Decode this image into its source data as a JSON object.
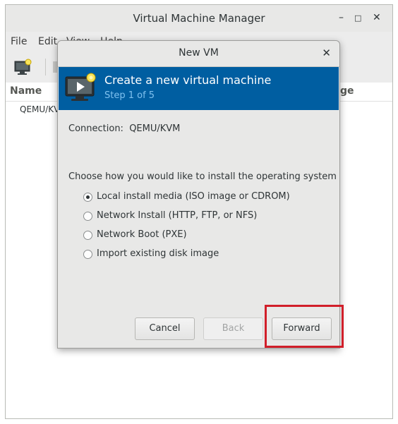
{
  "main_window": {
    "title": "Virtual Machine Manager",
    "menu": [
      "File",
      "Edit",
      "View",
      "Help"
    ],
    "columns": {
      "name": "Name",
      "usage": "ge"
    },
    "connections": [
      "QEMU/KV"
    ]
  },
  "dialog": {
    "title": "New VM",
    "banner": {
      "title": "Create a new virtual machine",
      "step": "Step 1 of 5"
    },
    "connection": "Connection:  QEMU/KVM",
    "install_prompt": "Choose how you would like to install the operating system",
    "options": [
      {
        "label": "Local install media (ISO image or CDROM)",
        "selected": true
      },
      {
        "label": "Network Install (HTTP, FTP, or NFS)",
        "selected": false
      },
      {
        "label": "Network Boot (PXE)",
        "selected": false
      },
      {
        "label": "Import existing disk image",
        "selected": false
      }
    ],
    "buttons": {
      "cancel": "Cancel",
      "back": "Back",
      "forward": "Forward"
    }
  },
  "colors": {
    "banner": "#005ea1",
    "highlight": "#d11f2a"
  }
}
